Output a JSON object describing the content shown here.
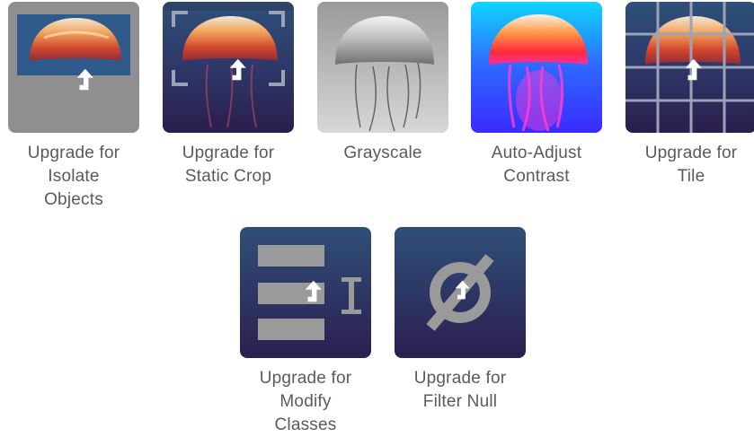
{
  "tiles": [
    {
      "id": "isolate-objects",
      "lines": [
        "Upgrade for",
        "Isolate",
        "Objects"
      ],
      "locked": true
    },
    {
      "id": "static-crop",
      "lines": [
        "Upgrade for",
        "Static Crop"
      ],
      "locked": true
    },
    {
      "id": "grayscale",
      "lines": [
        "Grayscale"
      ],
      "locked": false
    },
    {
      "id": "auto-adjust-contrast",
      "lines": [
        "Auto-Adjust",
        "Contrast"
      ],
      "locked": false
    },
    {
      "id": "tile",
      "lines": [
        "Upgrade for",
        "Tile"
      ],
      "locked": true
    },
    {
      "id": "modify-classes",
      "lines": [
        "Upgrade for",
        "Modify",
        "Classes"
      ],
      "locked": true
    },
    {
      "id": "filter-null",
      "lines": [
        "Upgrade for",
        "Filter Null"
      ],
      "locked": true
    }
  ],
  "icons": {
    "upgrade": "upgrade-arrow-icon",
    "crop": "crop-corners-icon",
    "grid": "grid-icon",
    "classes": "list-rename-icon",
    "null": "null-set-icon"
  },
  "colors": {
    "label_text": "#5a5a5a",
    "gray_tile": "#8a8a8a",
    "purple_dark": "#2b1f4f",
    "navy_top": "#2e4f7a"
  }
}
